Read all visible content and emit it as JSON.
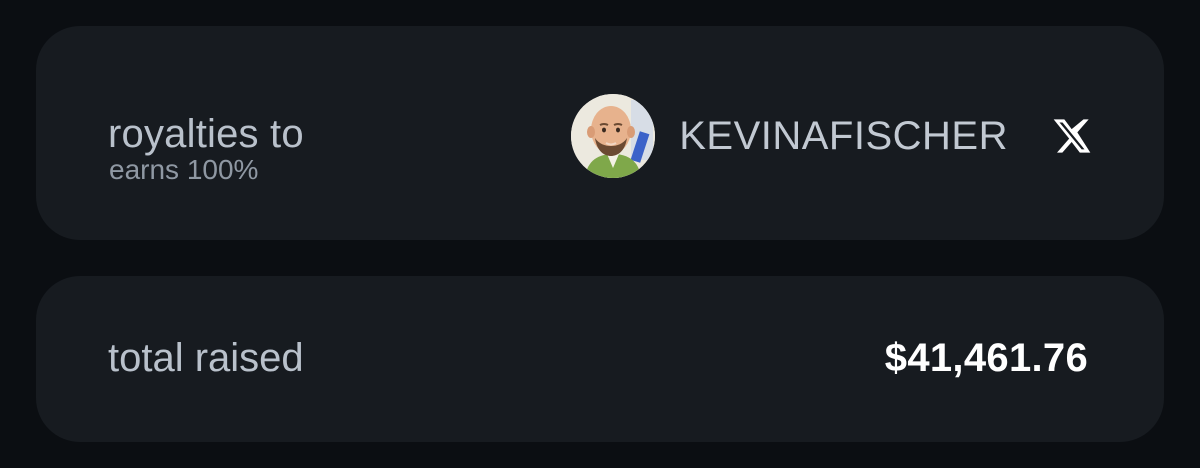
{
  "royalties": {
    "title": "royalties to",
    "subtitle": "earns 100%",
    "recipient": {
      "name": "KEVINAFISCHER",
      "avatar_icon": "avatar-image",
      "social_icon": "x-logo-icon"
    }
  },
  "raised": {
    "label": "total raised",
    "value": "$41,461.76"
  },
  "colors": {
    "background": "#0b0e12",
    "card": "#171b20",
    "label_text": "#b9c1cb",
    "sub_text": "#8f98a3",
    "value_text": "#ffffff"
  }
}
